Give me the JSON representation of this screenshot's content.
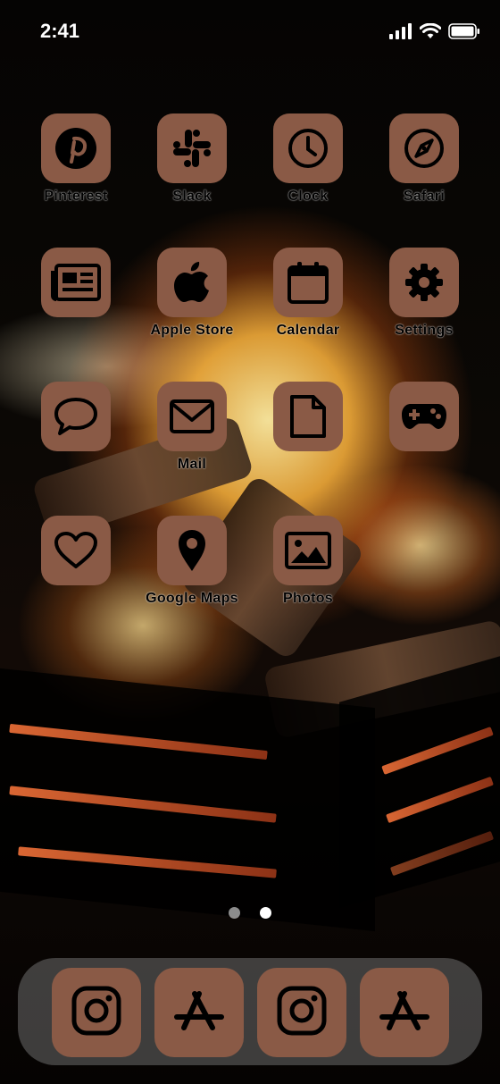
{
  "status_bar": {
    "time": "2:41",
    "icons": [
      "signal-icon",
      "wifi-icon",
      "battery-icon"
    ]
  },
  "theme": {
    "icon_background": "#8a5a46",
    "glyph_color": "#000000"
  },
  "apps": [
    {
      "label": "Pinterest",
      "icon": "pinterest-icon"
    },
    {
      "label": "Slack",
      "icon": "slack-icon"
    },
    {
      "label": "Clock",
      "icon": "clock-icon"
    },
    {
      "label": "Safari",
      "icon": "compass-icon"
    },
    {
      "label": "",
      "icon": "news-icon"
    },
    {
      "label": "Apple Store",
      "icon": "apple-icon"
    },
    {
      "label": "Calendar",
      "icon": "calendar-icon"
    },
    {
      "label": "Settings",
      "icon": "gear-icon"
    },
    {
      "label": "",
      "icon": "speech-bubble-icon"
    },
    {
      "label": "Mail",
      "icon": "mail-icon"
    },
    {
      "label": "",
      "icon": "document-icon"
    },
    {
      "label": "",
      "icon": "gamepad-icon"
    },
    {
      "label": "",
      "icon": "heart-icon"
    },
    {
      "label": "Google Maps",
      "icon": "map-pin-icon"
    },
    {
      "label": "Photos",
      "icon": "photos-icon"
    }
  ],
  "page_dots": {
    "count": 2,
    "active": 1
  },
  "dock": [
    {
      "icon": "instagram-icon"
    },
    {
      "icon": "app-store-icon"
    },
    {
      "icon": "instagram-icon"
    },
    {
      "icon": "app-store-icon"
    }
  ]
}
